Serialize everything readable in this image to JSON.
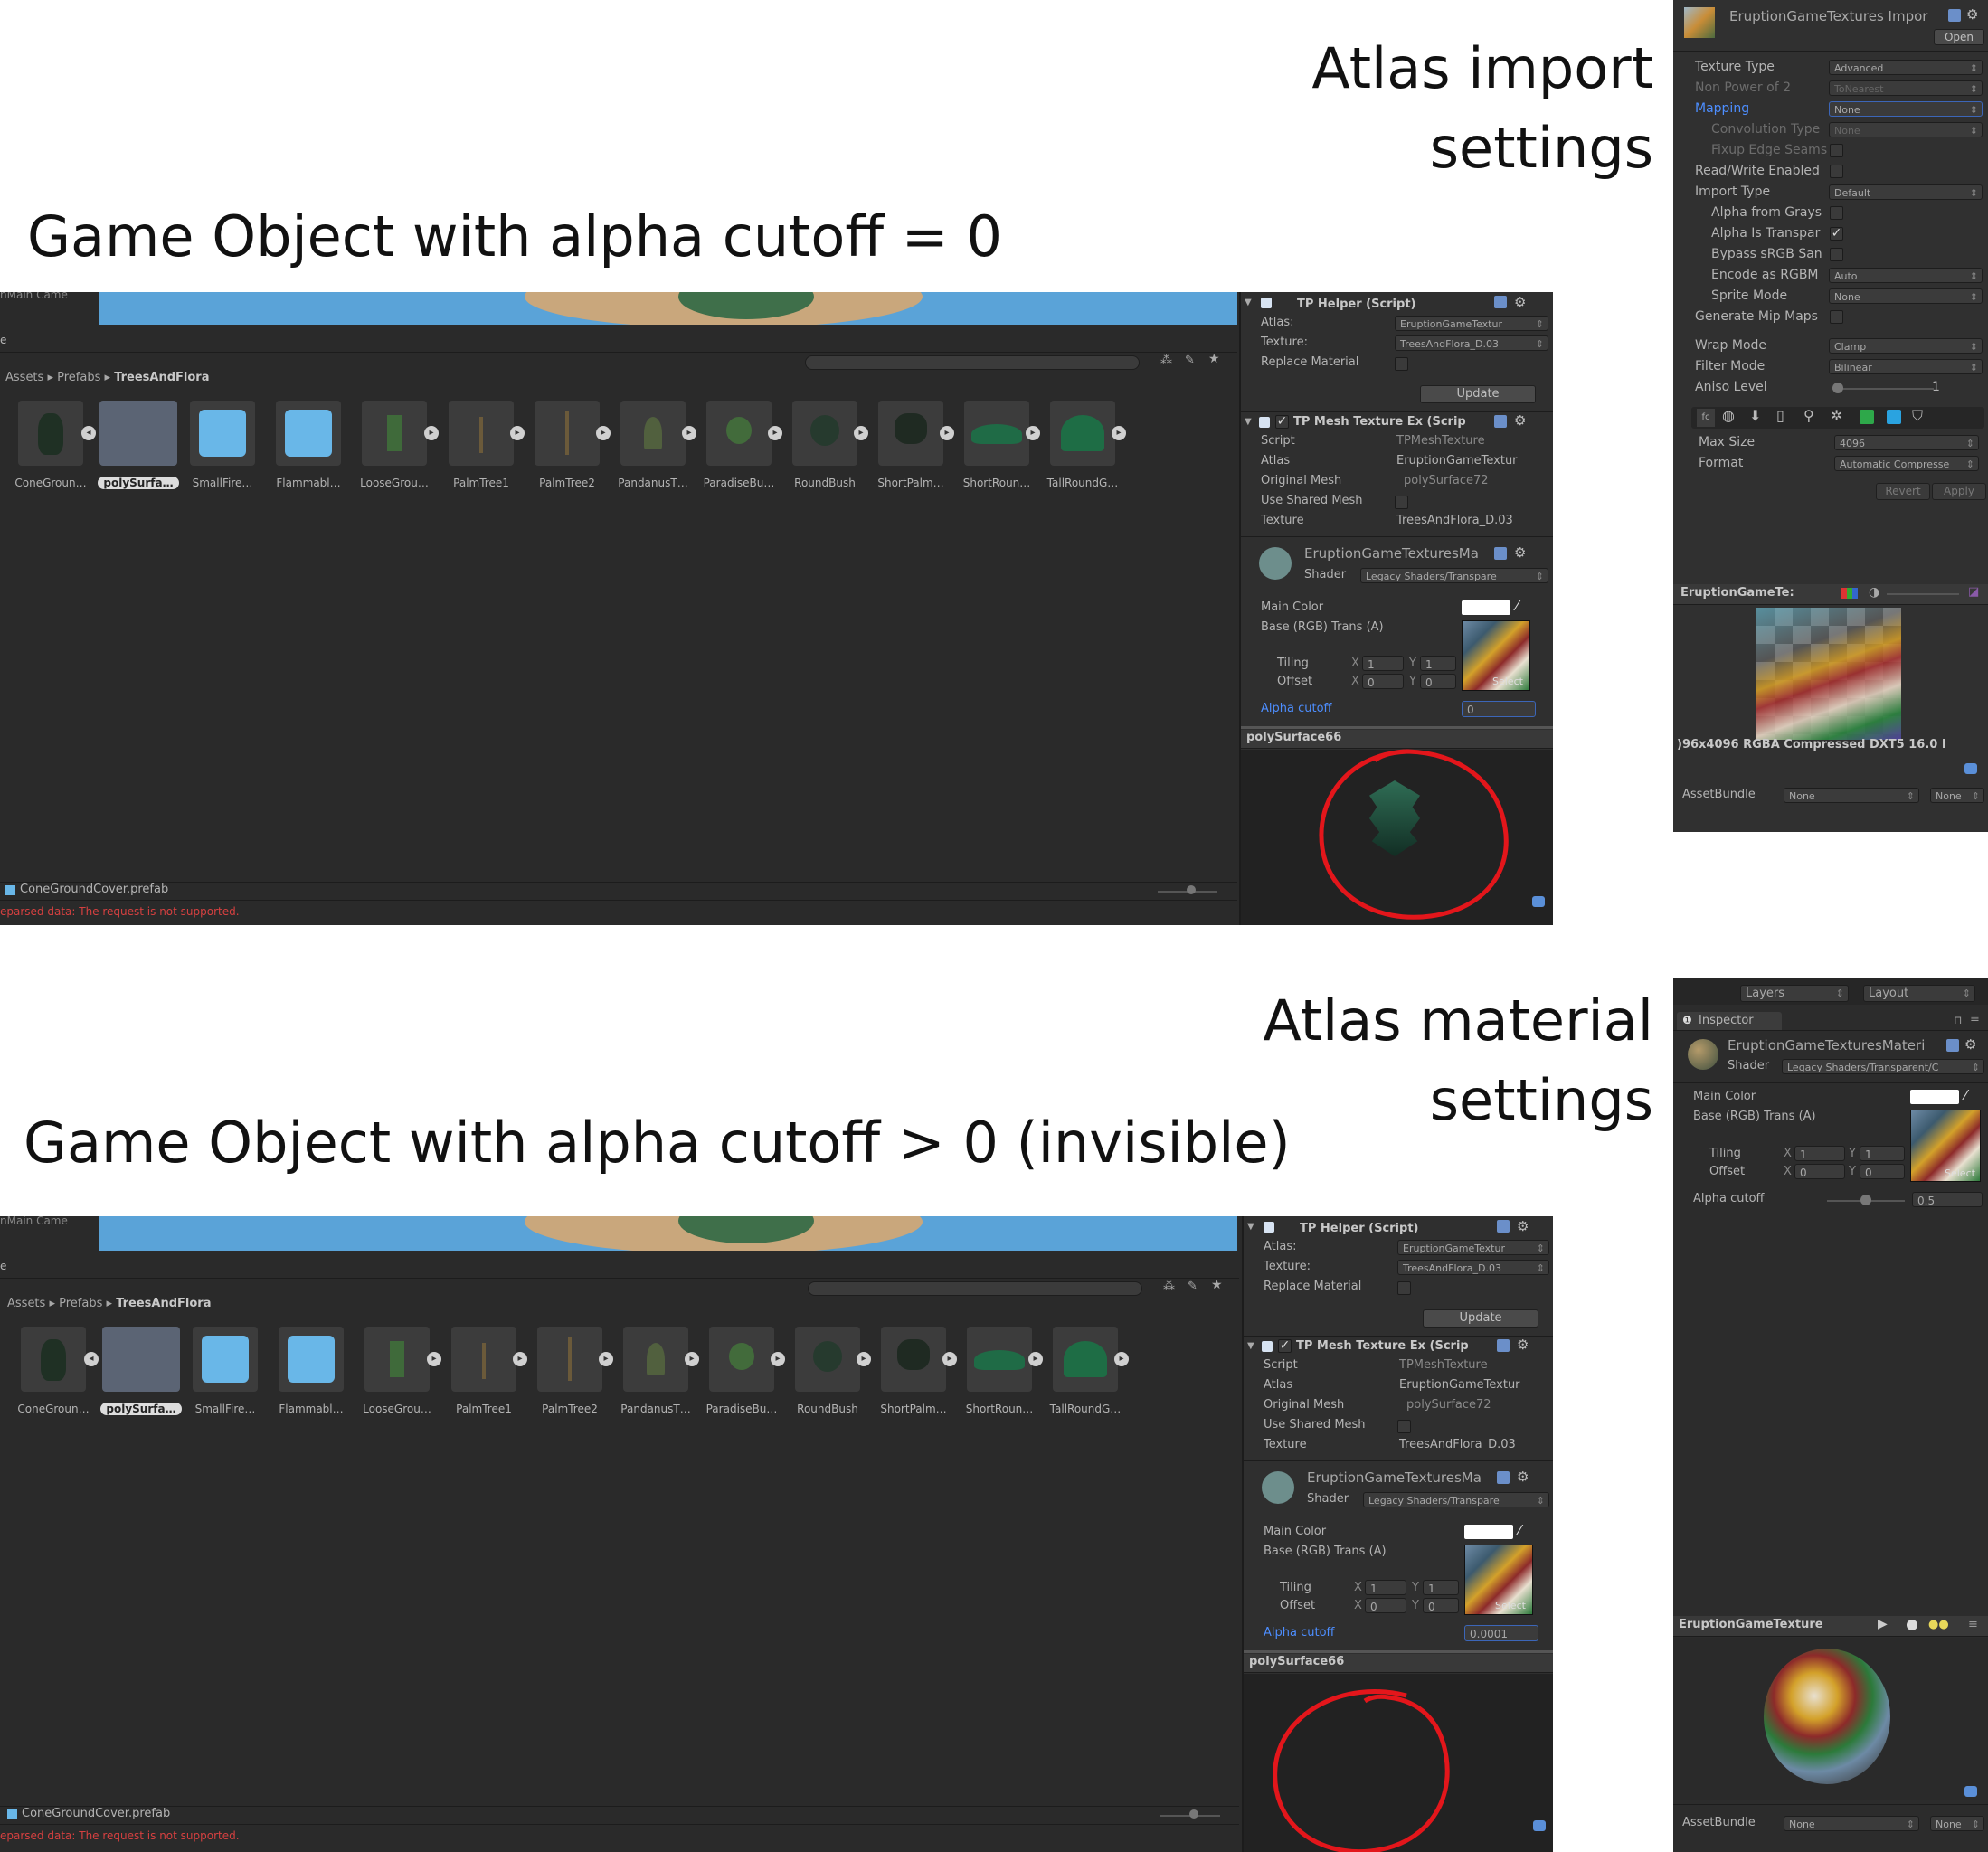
{
  "captions": {
    "import_title_line1": "Atlas import",
    "import_title_line2": "settings",
    "top_caption": "Game Object with alpha cutoff = 0",
    "material_title_line1": "Atlas material",
    "material_title_line2": "settings",
    "bottom_caption": "Game Object with alpha cutoff > 0 (invisible)"
  },
  "editor": {
    "hierarchy_fragment": "nMain Came",
    "tab_fragment": "e",
    "breadcrumb": [
      "Assets",
      "Prefabs",
      "TreesAndFlora"
    ],
    "assets": [
      "ConeGroun…",
      "polySurfa…",
      "SmallFire…",
      "Flammabl…",
      "LooseGrou…",
      "PalmTree1",
      "PalmTree2",
      "PandanusT…",
      "ParadiseBu…",
      "RoundBush",
      "ShortPalm…",
      "ShortRoun…",
      "TallRoundG…"
    ],
    "selected_asset_index": 1,
    "status_file": "ConeGroundCover.prefab",
    "error_text": "eparsed data: The request is not supported."
  },
  "inspector_common": {
    "tp_helper_title": "TP Helper (Script)",
    "atlas_label": "Atlas:",
    "atlas_value": "EruptionGameTextur",
    "texture_label": "Texture:",
    "texture_value": "TreesAndFlora_D.03",
    "replace_material_label": "Replace Material",
    "update_button": "Update",
    "tp_mesh_title": "TP Mesh Texture Ex (Scrip",
    "script_label": "Script",
    "script_value": "TPMeshTexture",
    "atlas2_label": "Atlas",
    "atlas2_value": "EruptionGameTextur",
    "original_mesh_label": "Original Mesh",
    "original_mesh_value": "polySurface72",
    "use_shared_mesh_label": "Use Shared Mesh",
    "texture2_label": "Texture",
    "texture2_value": "TreesAndFlora_D.03",
    "material_name": "EruptionGameTexturesMa",
    "shader_label": "Shader",
    "shader_value": "Legacy Shaders/Transpare",
    "main_color_label": "Main Color",
    "base_label": "Base (RGB) Trans (A)",
    "tiling_label": "Tiling",
    "offset_label": "Offset",
    "x_label": "X",
    "y_label": "Y",
    "tiling_x": "1",
    "tiling_y": "1",
    "offset_x": "0",
    "offset_y": "0",
    "select_label": "Select",
    "alpha_cutoff_label": "Alpha cutoff",
    "preview_title": "polySurface66"
  },
  "top_inspector": {
    "alpha_cutoff_value": "0"
  },
  "bottom_inspector": {
    "alpha_cutoff_value": "0.0001"
  },
  "import_panel": {
    "title": "EruptionGameTextures Impor",
    "open_button": "Open",
    "rows": [
      {
        "label": "Texture Type",
        "value": "Advanced"
      },
      {
        "label": "Non Power of 2",
        "value": "ToNearest"
      },
      {
        "label": "Mapping",
        "value": "None"
      },
      {
        "label": "Convolution Type",
        "value": "None"
      },
      {
        "label": "Fixup Edge Seams",
        "value": ""
      },
      {
        "label": "Read/Write Enabled",
        "value": ""
      },
      {
        "label": "Import Type",
        "value": "Default"
      },
      {
        "label": "Alpha from Grays",
        "value": ""
      },
      {
        "label": "Alpha Is Transpar",
        "value": ""
      },
      {
        "label": "Bypass sRGB San",
        "value": ""
      },
      {
        "label": "Encode as RGBM",
        "value": "Auto"
      },
      {
        "label": "Sprite Mode",
        "value": "None"
      },
      {
        "label": "Generate Mip Maps",
        "value": ""
      },
      {
        "label": "Wrap Mode",
        "value": "Clamp"
      },
      {
        "label": "Filter Mode",
        "value": "Bilinear"
      },
      {
        "label": "Aniso Level",
        "value": "1"
      }
    ],
    "max_size_label": "Max Size",
    "max_size_value": "4096",
    "format_label": "Format",
    "format_value": "Automatic Compresse",
    "revert_button": "Revert",
    "apply_button": "Apply",
    "preview_title": "EruptionGameTe:",
    "preview_info": ")96x4096  RGBA Compressed DXT5  16.0 I",
    "assetbundle_label": "AssetBundle",
    "assetbundle_value": "None",
    "assetbundle_variant": "None"
  },
  "material_panel": {
    "layers_label": "Layers",
    "layout_label": "Layout",
    "inspector_tab": "Inspector",
    "material_name": "EruptionGameTexturesMateri",
    "shader_label": "Shader",
    "shader_value": "Legacy Shaders/Transparent/C",
    "main_color_label": "Main Color",
    "base_label": "Base (RGB) Trans (A)",
    "tiling_label": "Tiling",
    "offset_label": "Offset",
    "tiling_x": "1",
    "tiling_y": "1",
    "offset_x": "0",
    "offset_y": "0",
    "select_label": "Select",
    "alpha_cutoff_label": "Alpha cutoff",
    "alpha_cutoff_value": "0.5",
    "preview_title": "EruptionGameTexture",
    "assetbundle_label": "AssetBundle",
    "assetbundle_value": "None",
    "assetbundle_variant": "None"
  }
}
